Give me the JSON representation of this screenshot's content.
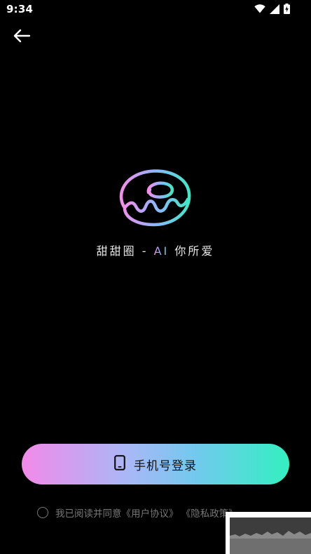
{
  "status_bar": {
    "time": "9:34",
    "icons": [
      "wifi-icon",
      "cellular-signal-icon",
      "battery-charging-icon"
    ]
  },
  "header": {
    "back_icon": "arrow-left-icon"
  },
  "brand": {
    "logo": "donut-logo",
    "slogan_prefix": "甜甜圈 - ",
    "slogan_ai": "AI",
    "slogan_suffix": " 你所爱"
  },
  "login": {
    "icon": "phone-icon",
    "label": "手机号登录",
    "gradient_colors": [
      "#f28ae9",
      "#72c9ee",
      "#33f0c1"
    ]
  },
  "agreement": {
    "text": "我已阅读并同意",
    "user_agreement": "《用户协议》",
    "privacy_policy": "《隐私政策》"
  },
  "colors": {
    "background": "#000000",
    "accent_pink": "#f48ee9",
    "accent_blue": "#7db8ff",
    "accent_green": "#44e7c8"
  }
}
